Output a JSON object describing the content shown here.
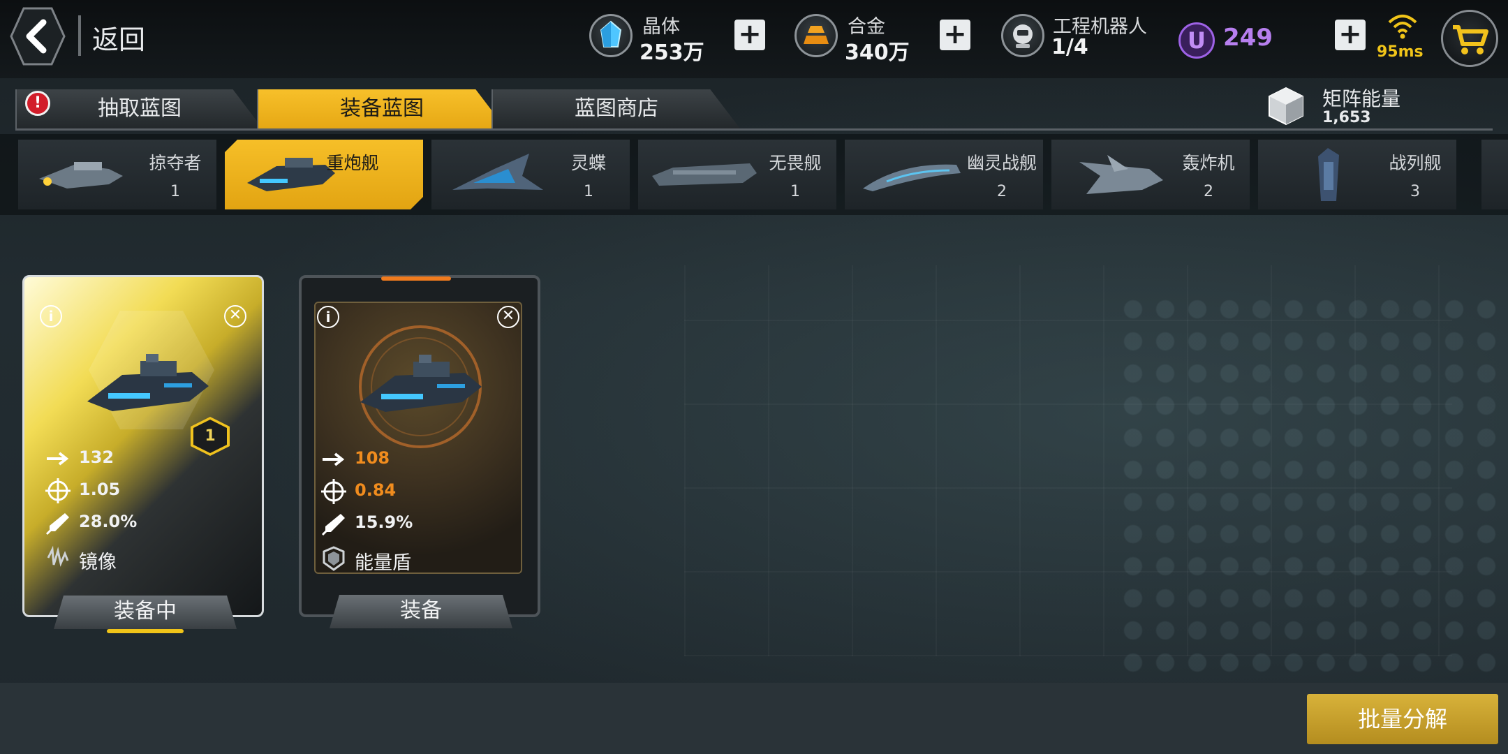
{
  "header": {
    "back_label": "返回"
  },
  "resources": {
    "crystal": {
      "name": "晶体",
      "value": "253万",
      "icon": "crystal-icon"
    },
    "alloy": {
      "name": "合金",
      "value": "340万",
      "icon": "alloy-icon"
    },
    "robot": {
      "name": "工程机器人",
      "value": "1/4",
      "icon": "robot-icon"
    },
    "ucoin": {
      "symbol": "U",
      "value": "249"
    }
  },
  "network": {
    "ping": "95ms"
  },
  "tabs": [
    {
      "label": "抽取蓝图",
      "active": false,
      "alert": "!"
    },
    {
      "label": "装备蓝图",
      "active": true
    },
    {
      "label": "蓝图商店",
      "active": false
    }
  ],
  "matrix_energy": {
    "label": "矩阵能量",
    "value": "1,653"
  },
  "categories": [
    {
      "name": "掠夺者",
      "count": "1",
      "active": false
    },
    {
      "name": "重炮舰",
      "count": "",
      "active": true
    },
    {
      "name": "灵蝶",
      "count": "1",
      "active": false
    },
    {
      "name": "无畏舰",
      "count": "1",
      "active": false
    },
    {
      "name": "幽灵战舰",
      "count": "2",
      "active": false
    },
    {
      "name": "轰炸机",
      "count": "2",
      "active": false
    },
    {
      "name": "战列舰",
      "count": "3",
      "active": false
    }
  ],
  "cards": [
    {
      "rank": "1",
      "speed": "132",
      "accuracy": "1.05",
      "rate": "28.0%",
      "skill": "镜像",
      "button": "装备中"
    },
    {
      "speed": "108",
      "accuracy": "0.84",
      "rate": "15.9%",
      "skill": "能量盾",
      "button": "装备"
    }
  ],
  "bulk_button": "批量分解",
  "colors": {
    "accent_yellow": "#f6bf28",
    "stat_orange": "#f08c1e",
    "u_purple": "#b77fef",
    "ping_yellow": "#f0c419"
  }
}
